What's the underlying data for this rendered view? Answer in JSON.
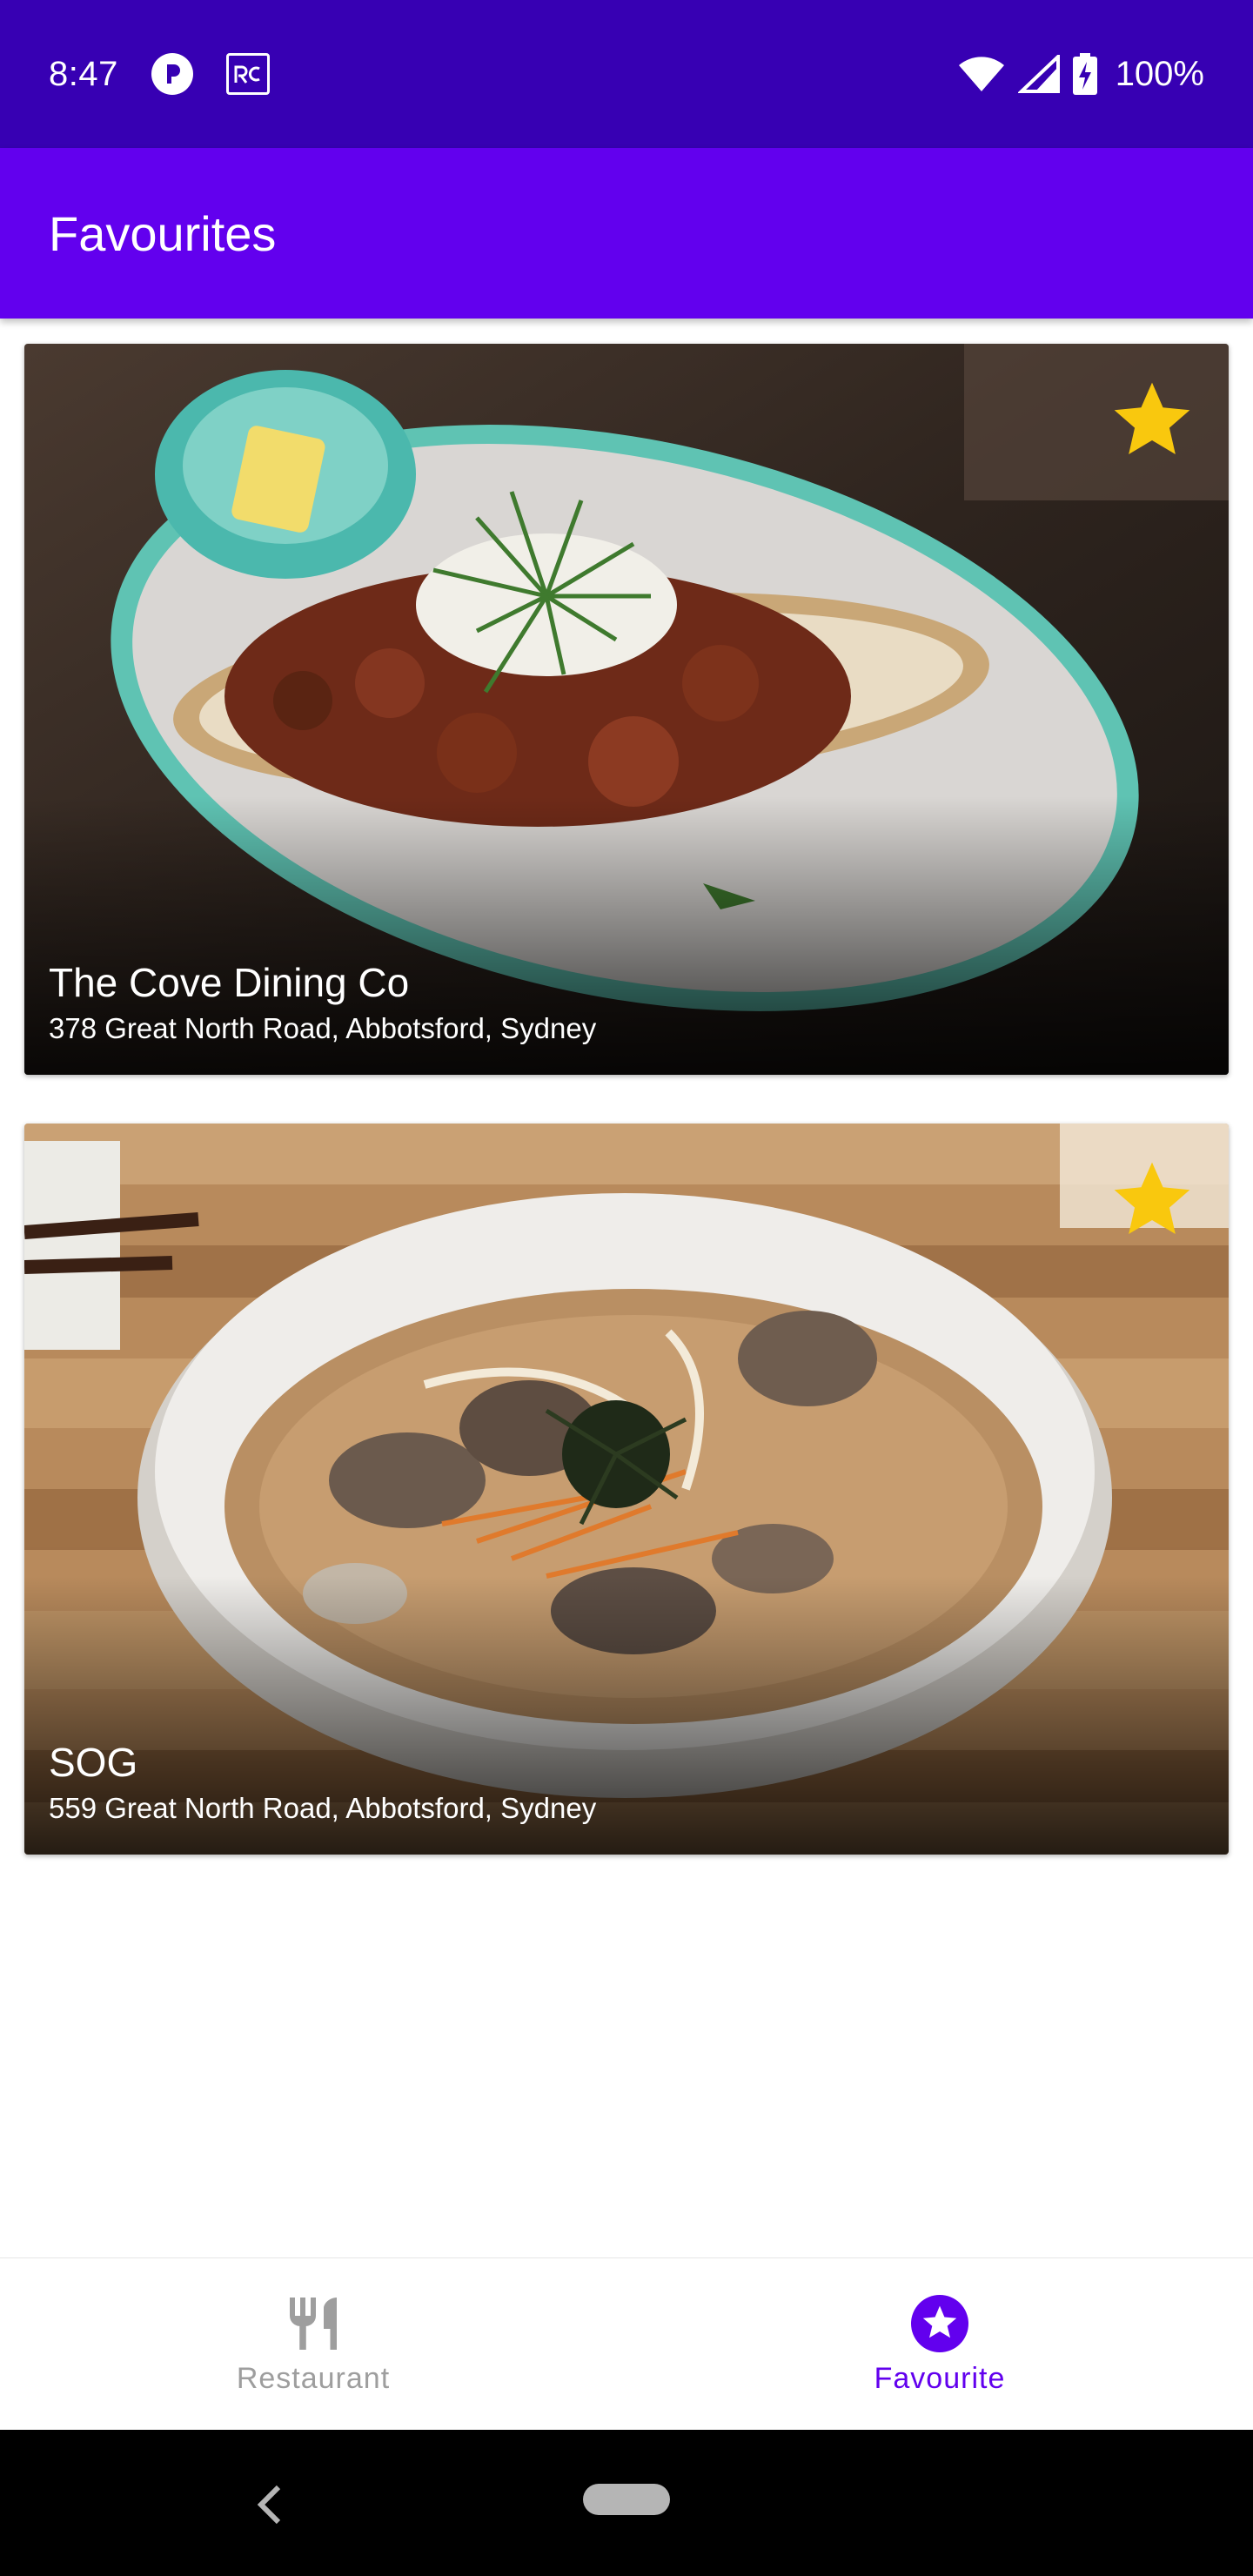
{
  "status_bar": {
    "time": "8:47",
    "notification_icons": [
      "p-circle-icon",
      "rc-square-icon"
    ],
    "battery": "100%"
  },
  "app_bar": {
    "title": "Favourites"
  },
  "restaurants": [
    {
      "name": "The Cove Dining Co",
      "address": "378 Great North Road, Abbotsford, Sydney",
      "favourited": true,
      "image": "bean-bruschetta-plate-photo"
    },
    {
      "name": "SOG",
      "address": "559 Great North Road, Abbotsford, Sydney",
      "favourited": true,
      "image": "clam-soup-bowl-photo"
    }
  ],
  "bottom_nav": {
    "items": [
      {
        "label": "Restaurant",
        "icon": "fork-knife-icon",
        "active": false
      },
      {
        "label": "Favourite",
        "icon": "star-circle-icon",
        "active": true
      }
    ]
  },
  "colors": {
    "status_bar": "#3700b3",
    "primary": "#6200ee",
    "star": "#f9c80e",
    "inactive": "#9e9e9e"
  }
}
